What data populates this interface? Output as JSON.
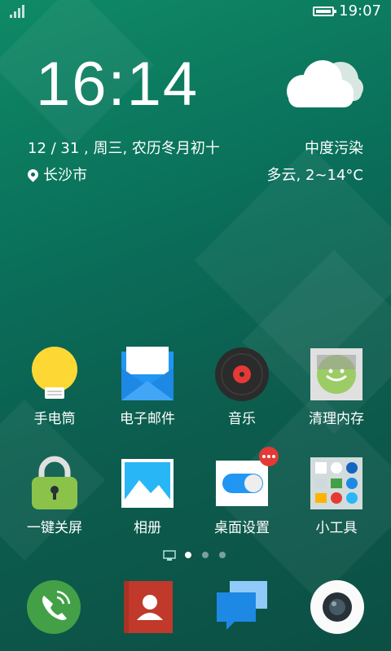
{
  "status": {
    "time": "19:07"
  },
  "lockscreen": {
    "clock": "16:14",
    "date": "12 / 31 , 周三, 农历冬月初十",
    "city": "长沙市",
    "air_quality": "中度污染",
    "weather": "多云, 2~14°C",
    "weather_icon": "cloud-icon"
  },
  "apps": [
    {
      "label": "手电筒",
      "icon": "flashlight-icon"
    },
    {
      "label": "电子邮件",
      "icon": "email-icon"
    },
    {
      "label": "音乐",
      "icon": "music-icon"
    },
    {
      "label": "清理内存",
      "icon": "memory-cleaner-icon"
    },
    {
      "label": "一键关屏",
      "icon": "lock-screen-icon"
    },
    {
      "label": "相册",
      "icon": "gallery-icon"
    },
    {
      "label": "桌面设置",
      "icon": "desktop-settings-icon"
    },
    {
      "label": "小工具",
      "icon": "widgets-folder-icon"
    }
  ],
  "pages": {
    "count": 3,
    "current": 1
  },
  "dock": [
    {
      "name": "phone",
      "icon": "phone-icon"
    },
    {
      "name": "contacts",
      "icon": "contacts-icon"
    },
    {
      "name": "messages",
      "icon": "messages-icon"
    },
    {
      "name": "camera",
      "icon": "camera-icon"
    }
  ],
  "colors": {
    "accent": "#0a6f5a",
    "badge": "#e53935"
  }
}
